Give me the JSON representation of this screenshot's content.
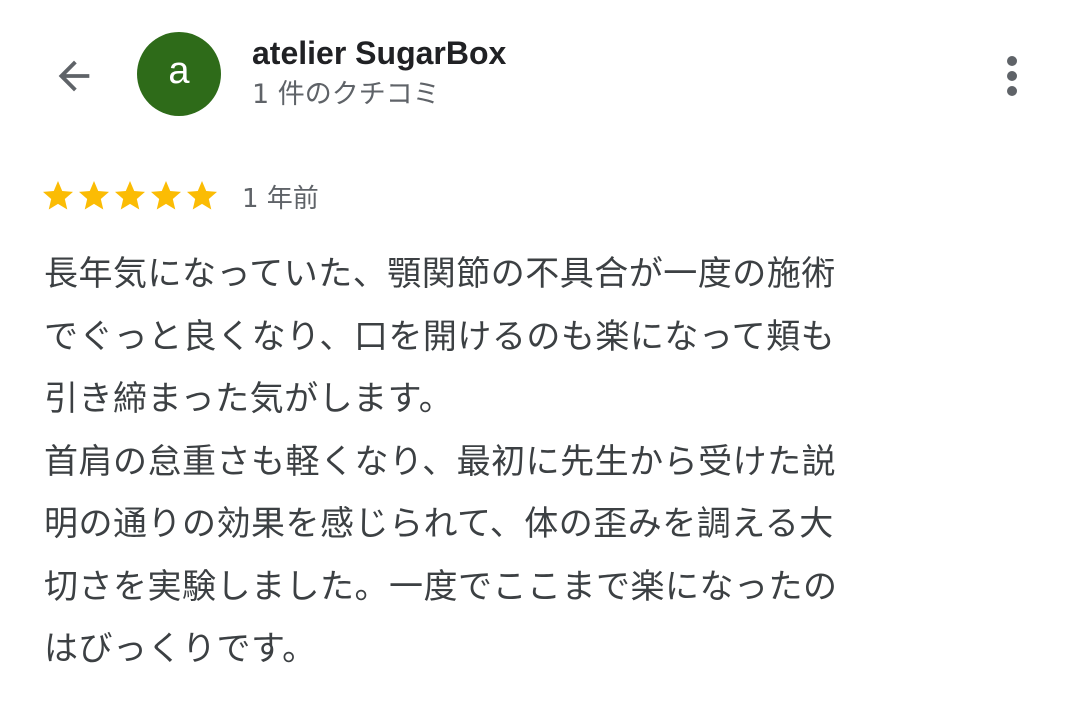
{
  "header": {
    "avatar_letter": "a",
    "avatar_color": "#2e6b19",
    "business_name": "atelier SugarBox",
    "review_count": "1 件のクチコミ",
    "back_icon": "arrow-back-icon",
    "more_icon": "more-vert-icon"
  },
  "review": {
    "rating": 5,
    "rating_max": 5,
    "star_color": "#fbbc04",
    "timestamp": "1 年前",
    "lines": [
      "長年気になっていた、顎関節の不具合が一度の施術",
      "でぐっと良くなり、口を開けるのも楽になって頬も",
      "引き締まった気がします。",
      "首肩の怠重さも軽くなり、最初に先生から受けた説",
      "明の通りの効果を感じられて、体の歪みを調える大",
      "切さを実験しました。一度でここまで楽になったの",
      "はびっくりです。"
    ]
  }
}
